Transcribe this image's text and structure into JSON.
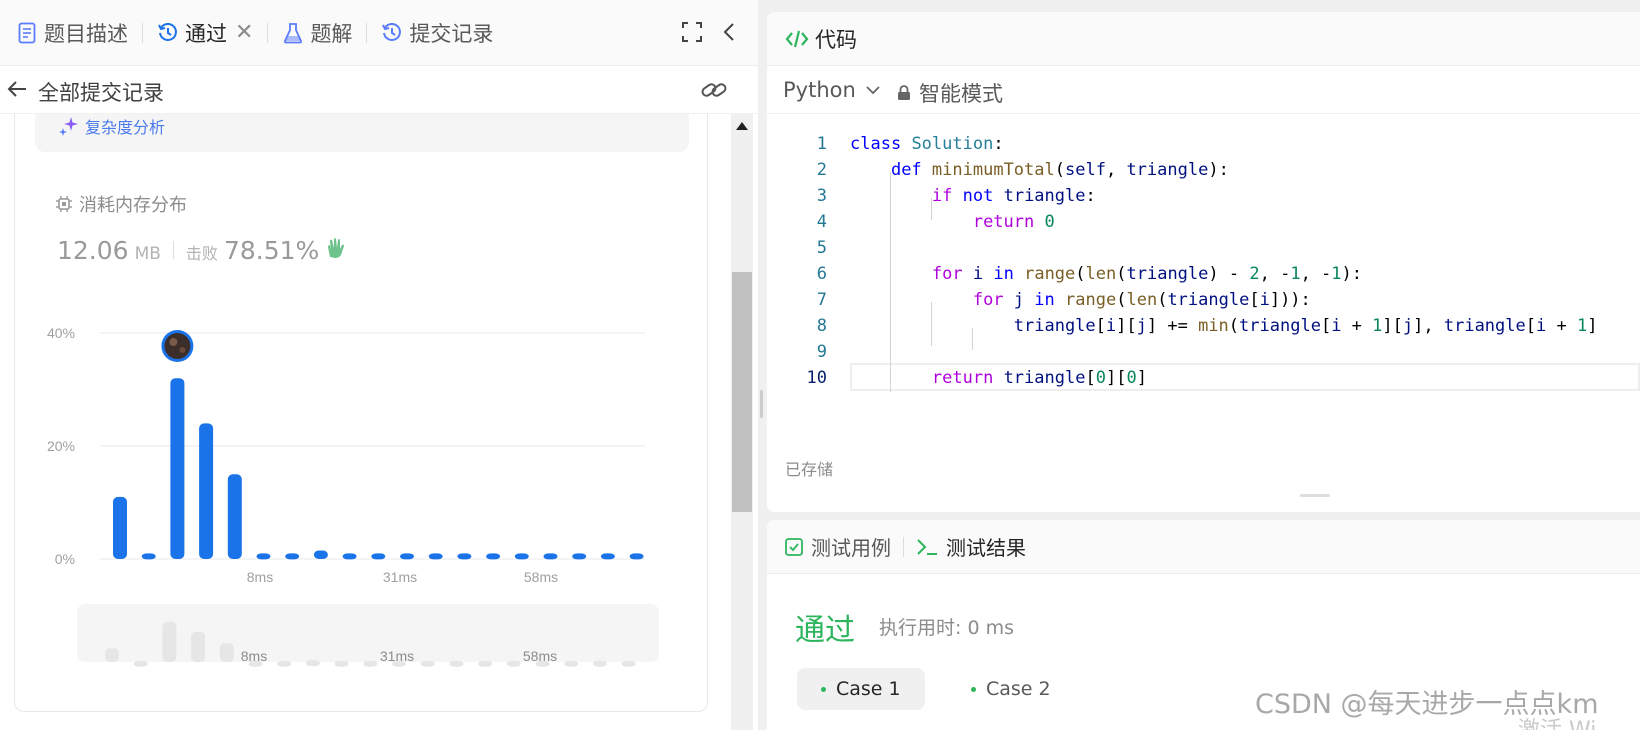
{
  "left_tabs": [
    {
      "label": "题目描述",
      "icon": "document-icon",
      "active": false
    },
    {
      "label": "通过",
      "icon": "history-icon",
      "active": true,
      "closable": true
    },
    {
      "label": "题解",
      "icon": "flask-icon",
      "active": false
    },
    {
      "label": "提交记录",
      "icon": "history-icon",
      "active": false
    }
  ],
  "subheader": {
    "title": "全部提交记录"
  },
  "complexity": {
    "label": "复杂度分析"
  },
  "memory": {
    "label": "消耗内存分布",
    "value": "12.06",
    "unit": "MB",
    "beats_label": "击败",
    "beats_value": "78.51%"
  },
  "chart_data": {
    "type": "bar",
    "title": "",
    "xlabel": "",
    "ylabel": "",
    "ylim": [
      0,
      40
    ],
    "yticks": [
      "40%",
      "20%",
      "0%"
    ],
    "xticks": [
      "8ms",
      "31ms",
      "58ms"
    ],
    "series": [
      {
        "values": [
          11,
          1,
          32,
          24,
          15,
          1,
          1,
          1.5,
          1,
          1,
          1,
          1,
          1,
          1,
          1,
          1,
          1,
          1,
          1
        ]
      }
    ],
    "highlight_index": 2,
    "color": "#1a73e8",
    "grid": true
  },
  "mini_chart": {
    "xticks": [
      "8ms",
      "31ms",
      "58ms"
    ]
  },
  "code_panel": {
    "title": "代码",
    "language": "Python",
    "mode": "智能模式",
    "saved": "已存储",
    "lines": [
      {
        "n": "1"
      },
      {
        "n": "2"
      },
      {
        "n": "3"
      },
      {
        "n": "4"
      },
      {
        "n": "5"
      },
      {
        "n": "6"
      },
      {
        "n": "7"
      },
      {
        "n": "8"
      },
      {
        "n": "9"
      },
      {
        "n": "10"
      }
    ]
  },
  "test_panel": {
    "tabs": [
      "测试用例",
      "测试结果"
    ],
    "status": "通过",
    "runtime": "执行用时: 0 ms",
    "cases": [
      "Case 1",
      "Case 2"
    ]
  },
  "watermark": "CSDN @每天进步一点点km",
  "watermark2": "激活 Wi"
}
